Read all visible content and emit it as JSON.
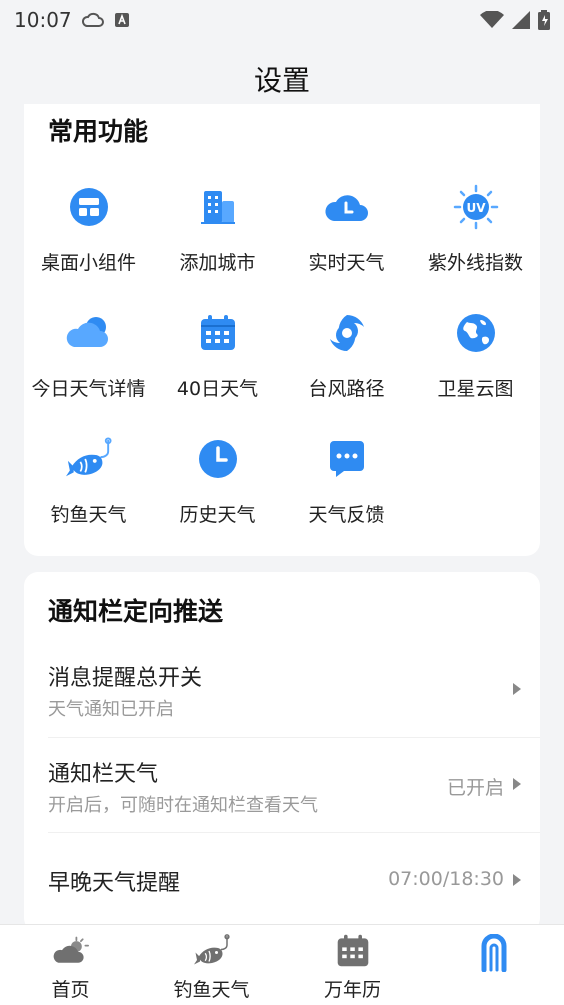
{
  "status_bar": {
    "time": "10:07"
  },
  "header": {
    "title": "设置"
  },
  "common": {
    "title": "常用功能",
    "items": [
      {
        "label": "桌面小组件",
        "icon": "widget-icon"
      },
      {
        "label": "添加城市",
        "icon": "building-icon"
      },
      {
        "label": "实时天气",
        "icon": "cloud-clock-icon"
      },
      {
        "label": "紫外线指数",
        "icon": "uv-sun-icon"
      },
      {
        "label": "今日天气详情",
        "icon": "cloud-moon-icon"
      },
      {
        "label": "40日天气",
        "icon": "calendar-icon"
      },
      {
        "label": "台风路径",
        "icon": "typhoon-icon"
      },
      {
        "label": "卫星云图",
        "icon": "globe-icon"
      },
      {
        "label": "钓鱼天气",
        "icon": "fish-icon"
      },
      {
        "label": "历史天气",
        "icon": "clock-icon"
      },
      {
        "label": "天气反馈",
        "icon": "chat-icon"
      }
    ]
  },
  "notify": {
    "title": "通知栏定向推送",
    "rows": [
      {
        "title": "消息提醒总开关",
        "subtitle": "天气通知已开启",
        "value": ""
      },
      {
        "title": "通知栏天气",
        "subtitle": "开启后，可随时在通知栏查看天气",
        "value": "已开启"
      },
      {
        "title": "早晚天气提醒",
        "subtitle": "",
        "value": "07:00/18:30"
      }
    ]
  },
  "tabs": [
    {
      "label": "首页",
      "icon": "weather-home-icon"
    },
    {
      "label": "钓鱼天气",
      "icon": "fish-tab-icon"
    },
    {
      "label": "万年历",
      "icon": "calendar-tab-icon"
    },
    {
      "label": "",
      "icon": "settings-a-icon"
    }
  ],
  "colors": {
    "accent": "#2f8bf2",
    "icon_light": "#58a8ff"
  }
}
